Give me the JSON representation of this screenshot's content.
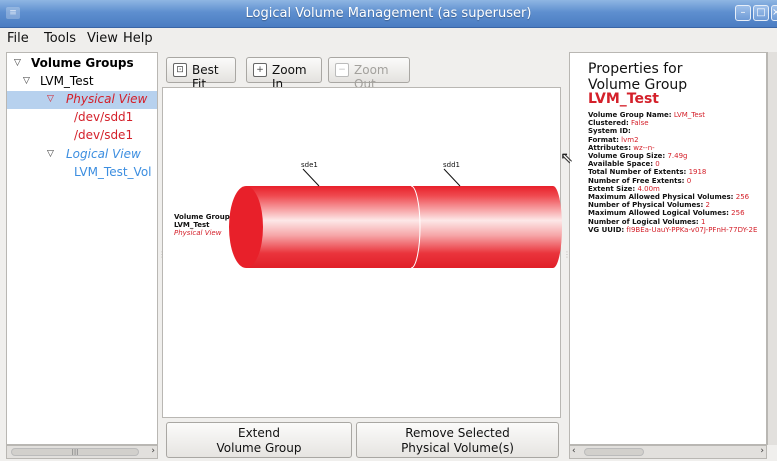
{
  "window": {
    "title": "Logical Volume Management (as superuser)",
    "menu_icon": "window-menu-icon",
    "controls": [
      "minimize",
      "maximize",
      "close"
    ]
  },
  "menu": {
    "items": [
      "File",
      "Tools",
      "View",
      "Help"
    ]
  },
  "tree": {
    "root_label": "Volume Groups",
    "group_label": "LVM_Test",
    "physical_view_label": "Physical View",
    "pv1": "/dev/sdd1",
    "pv2": "/dev/sde1",
    "logical_view_label": "Logical View",
    "lv1": "LVM_Test_Vol"
  },
  "toolbar": {
    "best_fit": "Best Fit",
    "zoom_in": "Zoom In",
    "zoom_out": "Zoom Out"
  },
  "diagram": {
    "vg_caption_line1": "Volume Group",
    "vg_caption_line2": "LVM_Test",
    "vg_caption_line3": "Physical View",
    "segment1_label": "sde1",
    "segment2_label": "sdd1",
    "cylinder_color": "#e8202a"
  },
  "actions": {
    "extend_line1": "Extend",
    "extend_line2": "Volume Group",
    "remove_line1": "Remove Selected",
    "remove_line2": "Physical Volume(s)"
  },
  "properties": {
    "heading_line1": "Properties for",
    "heading_line2": "Volume Group",
    "name": "LVM_Test",
    "rows": [
      {
        "key": "Volume Group Name:",
        "value": "LVM_Test"
      },
      {
        "key": "Clustered:",
        "value": "False"
      },
      {
        "key": "System ID:",
        "value": ""
      },
      {
        "key": "Format:",
        "value": "lvm2"
      },
      {
        "key": "Attributes:",
        "value": "wz--n-"
      },
      {
        "key": "Volume Group Size:",
        "value": "7.49g"
      },
      {
        "key": "Available Space:",
        "value": "0"
      },
      {
        "key": "Total Number of Extents:",
        "value": "1918"
      },
      {
        "key": "Number of Free Extents:",
        "value": "0"
      },
      {
        "key": "Extent Size:",
        "value": "4.00m"
      },
      {
        "key": "Maximum Allowed Physical Volumes:",
        "value": "256"
      },
      {
        "key": "Number of Physical Volumes:",
        "value": "2"
      },
      {
        "key": "Maximum Allowed Logical Volumes:",
        "value": "256"
      },
      {
        "key": "Number of Logical Volumes:",
        "value": "1"
      },
      {
        "key": "VG UUID:",
        "value": "fI9BEa-UauY-PPKa-v07J-PFnH-77DY-2E"
      }
    ]
  },
  "colors": {
    "accent_red": "#d4202a",
    "selection_blue": "#b7d1ee",
    "tree_link_blue": "#3c8ee0"
  }
}
